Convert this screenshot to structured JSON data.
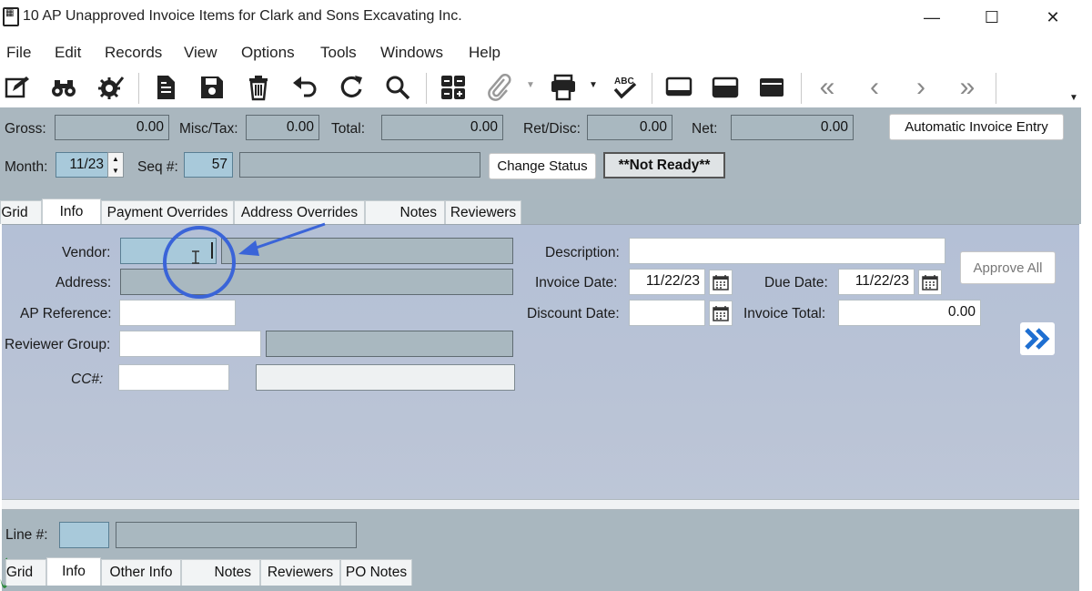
{
  "window": {
    "title": "10 AP Unapproved Invoice Items for Clark and Sons Excavating Inc.",
    "controls": [
      "—",
      "☐",
      "✕"
    ]
  },
  "menu": [
    "File",
    "Edit",
    "Records",
    "View",
    "Options",
    "Tools",
    "Windows",
    "Help"
  ],
  "header": {
    "gross_label": "Gross:",
    "gross_value": "0.00",
    "misc_label": "Misc/Tax:",
    "misc_value": "0.00",
    "total_label": "Total:",
    "total_value": "0.00",
    "ret_label": "Ret/Disc:",
    "ret_value": "0.00",
    "net_label": "Net:",
    "net_value": "0.00",
    "auto_invoice_button": "Automatic Invoice Entry",
    "month_label": "Month:",
    "month_value": "11/23",
    "seq_label": "Seq #:",
    "seq_value": "57",
    "change_status_button": "Change Status",
    "status_badge": "**Not Ready**"
  },
  "tabs": [
    "Grid",
    "Info",
    "Payment Overrides",
    "Address Overrides",
    "Notes",
    "Reviewers"
  ],
  "info": {
    "vendor_label": "Vendor:",
    "address_label": "Address:",
    "ap_reference_label": "AP Reference:",
    "reviewer_group_label": "Reviewer Group:",
    "cc_label": "CC#:",
    "description_label": "Description:",
    "invoice_date_label": "Invoice Date:",
    "invoice_date_value": "11/22/23",
    "due_date_label": "Due Date:",
    "due_date_value": "11/22/23",
    "discount_date_label": "Discount Date:",
    "invoice_total_label": "Invoice Total:",
    "invoice_total_value": "0.00",
    "approve_all_button": "Approve All"
  },
  "line": {
    "line_label": "Line #:"
  },
  "bottom_tabs": [
    "Grid",
    "Info",
    "Other Info",
    "Notes",
    "Reviewers",
    "PO Notes"
  ],
  "colors": {
    "panel": "#aab7bf",
    "info_panel": "#b8c2d6",
    "highlight_field": "#a8c9da",
    "annotation_blue": "#3a64d8"
  }
}
